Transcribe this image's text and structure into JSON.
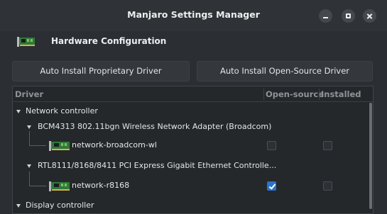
{
  "window": {
    "title": "Manjaro Settings Manager",
    "controls": [
      "minimize-icon",
      "maximize-icon",
      "close-icon"
    ]
  },
  "header": {
    "icon": "hardware-card-icon",
    "label": "Hardware Configuration"
  },
  "buttons": {
    "proprietary": "Auto Install Proprietary Driver",
    "open_source": "Auto Install Open-Source Driver"
  },
  "table": {
    "columns": [
      "Driver",
      "Open-source",
      "Installed"
    ],
    "rows": [
      {
        "type": "category",
        "label": "Network controller"
      },
      {
        "type": "device",
        "label": "BCM4313 802.11bgn Wireless Network Adapter (Broadcom)"
      },
      {
        "type": "driver",
        "label": "network-broadcom-wl",
        "open_source": false,
        "installed": false
      },
      {
        "type": "device",
        "label": "RTL8111/8168/8411 PCI Express Gigabit Ethernet Controlle..."
      },
      {
        "type": "driver",
        "label": "network-r8168",
        "open_source": true,
        "installed": false
      },
      {
        "type": "category",
        "label": "Display controller"
      }
    ]
  },
  "colors": {
    "background": "#2b2e32",
    "checkbox_checked": "#2b73c8"
  }
}
